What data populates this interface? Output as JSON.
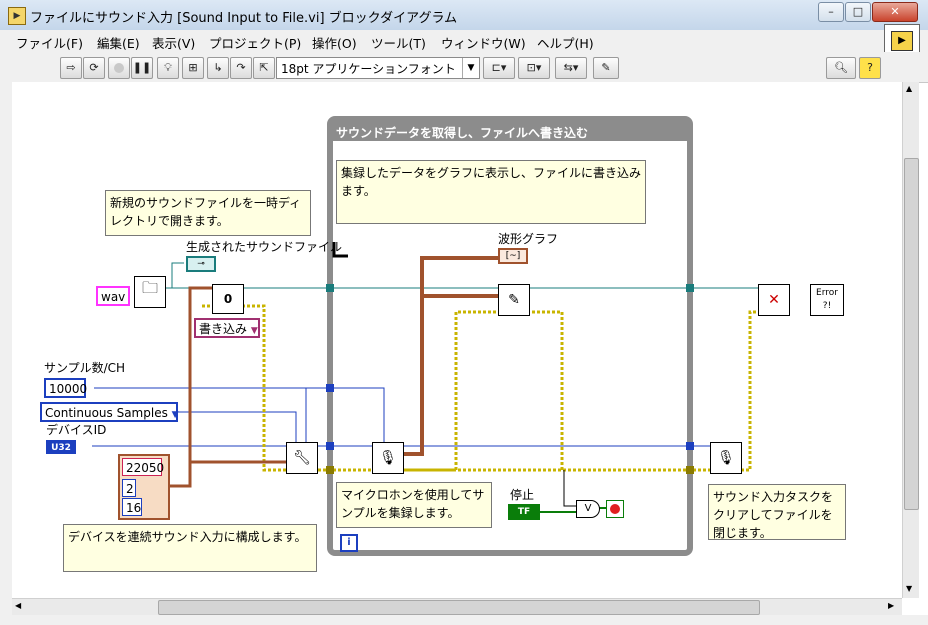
{
  "window": {
    "title": "ファイルにサウンド入力 [Sound Input to File.vi] ブロックダイアグラム",
    "icon": "labview-vi-icon",
    "buttons": {
      "minimize": "–",
      "maximize": "□",
      "close": "✕"
    }
  },
  "menu": [
    "ファイル(F)",
    "編集(E)",
    "表示(V)",
    "プロジェクト(P)",
    "操作(O)",
    "ツール(T)",
    "ウィンドウ(W)",
    "ヘルプ(H)"
  ],
  "toolbar": {
    "font_selector": "18pt アプリケーションフォント",
    "icons": [
      "run-arrow-icon",
      "run-continuously-icon",
      "abort-icon",
      "pause-icon",
      "highlight-execution-icon",
      "retain-wire-values-icon",
      "step-into-icon",
      "step-over-icon",
      "step-out-icon",
      "align-icon",
      "distribute-icon",
      "reorder-icon",
      "cleanup-icon",
      "search-icon",
      "context-help-icon"
    ]
  },
  "diagram": {
    "loop": {
      "title": "サウンドデータを取得し、ファイルへ書き込む",
      "note": "集録したデータをグラフに表示し、ファイルに書き込みます。",
      "iteration_terminal": "i"
    },
    "notes": {
      "temp_file": "新規のサウンドファイルを一時ディレクトリで開きます。",
      "configure": "デバイスを連続サウンド入力に構成します。",
      "acquire": "マイクロホンを使用してサンプルを集録します。",
      "clear": "サウンド入力タスクをクリアしてファイルを閉じます。"
    },
    "labels": {
      "generated_file": "生成されたサウンドファイル",
      "samples_per_ch": "サンプル数/CH",
      "device_id": "デバイスID",
      "waveform_graph": "波形グラフ",
      "stop": "停止"
    },
    "constants": {
      "file_ext": "wav",
      "mode": "書き込み",
      "samples": "10000",
      "sample_mode": "Continuous Samples",
      "device_id_type": "U32",
      "rate": "22050",
      "channels": "2",
      "bits": "16",
      "open_value": "0",
      "stop_value": "TF",
      "or_symbol": "V",
      "error_label": "Error ?!"
    }
  },
  "colors": {
    "wire_refnum": "#1a7c7c",
    "wire_error": "#c8b400",
    "wire_waveform": "#a0522d",
    "wire_int": "#1c3fbf",
    "loop_frame": "#8c8c8c",
    "note_bg": "#ffffe1"
  }
}
